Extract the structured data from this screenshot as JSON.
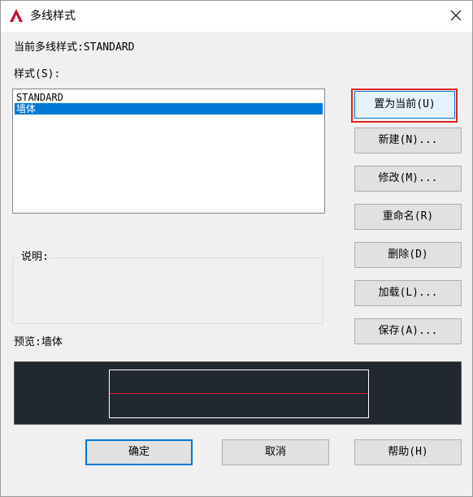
{
  "window": {
    "title": "多线样式",
    "close_icon": "close-icon",
    "app_icon": "autocad-logo-icon"
  },
  "current_style": {
    "label": "当前多线样式:STANDARD"
  },
  "styles": {
    "label": "样式(S):",
    "items": [
      {
        "label": "STANDARD",
        "selected": false
      },
      {
        "label": "墙体",
        "selected": true
      }
    ]
  },
  "description": {
    "label": "说明:",
    "value": ""
  },
  "preview": {
    "label": "预览:墙体",
    "background_color": "#212830",
    "frame_color": "#ffffff",
    "line_color": "#e0202a"
  },
  "side_buttons": {
    "set_current": "置为当前(U)",
    "new": "新建(N)...",
    "modify": "修改(M)...",
    "rename": "重命名(R)",
    "delete": "删除(D)",
    "load": "加载(L)...",
    "save": "保存(A)..."
  },
  "footer_buttons": {
    "ok": "确定",
    "cancel": "取消",
    "help": "帮助(H)"
  },
  "colors": {
    "accent": "#0078d7",
    "annotation_highlight": "#e02424"
  }
}
